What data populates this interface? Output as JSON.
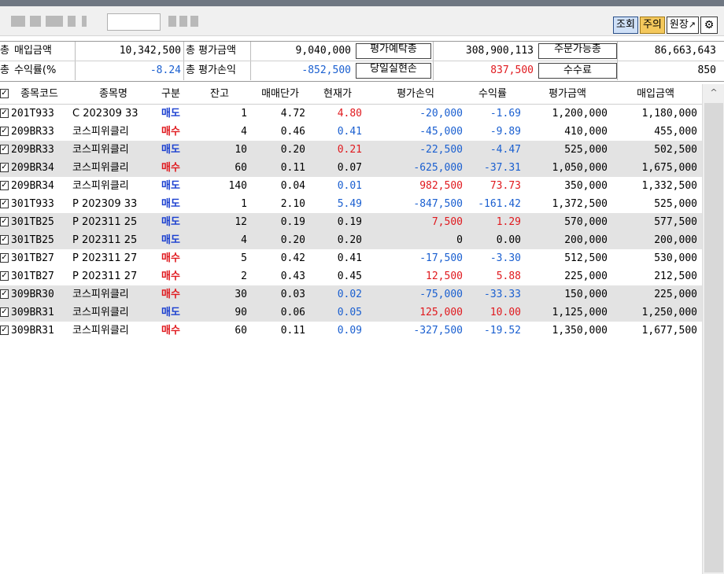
{
  "toolbar": {
    "query_label": "조회",
    "caution_label": "주의",
    "ledger_label": "원장",
    "ledger_icon": "external-link-icon",
    "settings_icon": "gear-icon"
  },
  "summary": {
    "row1": {
      "purchase_amount_label": "매입금액",
      "purchase_amount_value": "10,342,500",
      "total_eval_label": "총 평가금액",
      "total_eval_value": "9,040,000",
      "eval_deposit_button": "평가예탁총",
      "eval_deposit_value": "308,900,113",
      "orderable_button": "주문가능총",
      "orderable_value": "86,663,643"
    },
    "row2": {
      "return_rate_label": "수익률(%",
      "return_rate_value": "-8.24",
      "total_pl_label": "총 평가손익",
      "total_pl_value": "-852,500",
      "realized_button": "당일실현손",
      "realized_value": "837,500",
      "fee_button": "수수료",
      "fee_value": "850"
    },
    "prefix_total": "총",
    "prefix_total2": "총"
  },
  "table": {
    "headers": [
      "종목코드",
      "종목명",
      "구분",
      "잔고",
      "매매단가",
      "현재가",
      "평가손익",
      "수익률",
      "평가금액",
      "매입금액"
    ],
    "rows": [
      {
        "code": "201T933",
        "name": "C 202309 33",
        "side": "매도",
        "qty": "1",
        "avg": "4.72",
        "cur": "4.80",
        "pl": "-20,000",
        "rate": "-1.69",
        "eval": "1,200,000",
        "buy": "1,180,000",
        "cur_c": "pos",
        "pl_c": "neg",
        "rate_c": "neg"
      },
      {
        "code": "209BR33",
        "name": "코스피위클리",
        "side": "매수",
        "qty": "4",
        "avg": "0.46",
        "cur": "0.41",
        "pl": "-45,000",
        "rate": "-9.89",
        "eval": "410,000",
        "buy": "455,000",
        "cur_c": "neg",
        "pl_c": "neg",
        "rate_c": "neg"
      },
      {
        "code": "209BR33",
        "name": "코스피위클리",
        "side": "매도",
        "qty": "10",
        "avg": "0.20",
        "cur": "0.21",
        "pl": "-22,500",
        "rate": "-4.47",
        "eval": "525,000",
        "buy": "502,500",
        "cur_c": "pos",
        "pl_c": "neg",
        "rate_c": "neg"
      },
      {
        "code": "209BR34",
        "name": "코스피위클리",
        "side": "매수",
        "qty": "60",
        "avg": "0.11",
        "cur": "0.07",
        "pl": "-625,000",
        "rate": "-37.31",
        "eval": "1,050,000",
        "buy": "1,675,000",
        "cur_c": "",
        "pl_c": "neg",
        "rate_c": "neg"
      },
      {
        "code": "209BR34",
        "name": "코스피위클리",
        "side": "매도",
        "qty": "140",
        "avg": "0.04",
        "cur": "0.01",
        "pl": "982,500",
        "rate": "73.73",
        "eval": "350,000",
        "buy": "1,332,500",
        "cur_c": "neg",
        "pl_c": "pos",
        "rate_c": "pos"
      },
      {
        "code": "301T933",
        "name": "P 202309 33",
        "side": "매도",
        "qty": "1",
        "avg": "2.10",
        "cur": "5.49",
        "pl": "-847,500",
        "rate": "-161.42",
        "eval": "1,372,500",
        "buy": "525,000",
        "cur_c": "neg",
        "pl_c": "neg",
        "rate_c": "neg"
      },
      {
        "code": "301TB25",
        "name": "P 202311 25",
        "side": "매도",
        "qty": "12",
        "avg": "0.19",
        "cur": "0.19",
        "pl": "7,500",
        "rate": "1.29",
        "eval": "570,000",
        "buy": "577,500",
        "cur_c": "",
        "pl_c": "pos",
        "rate_c": "pos"
      },
      {
        "code": "301TB25",
        "name": "P 202311 25",
        "side": "매도",
        "qty": "4",
        "avg": "0.20",
        "cur": "0.20",
        "pl": "0",
        "rate": "0.00",
        "eval": "200,000",
        "buy": "200,000",
        "cur_c": "",
        "pl_c": "",
        "rate_c": ""
      },
      {
        "code": "301TB27",
        "name": "P 202311 27",
        "side": "매수",
        "qty": "5",
        "avg": "0.42",
        "cur": "0.41",
        "pl": "-17,500",
        "rate": "-3.30",
        "eval": "512,500",
        "buy": "530,000",
        "cur_c": "",
        "pl_c": "neg",
        "rate_c": "neg"
      },
      {
        "code": "301TB27",
        "name": "P 202311 27",
        "side": "매수",
        "qty": "2",
        "avg": "0.43",
        "cur": "0.45",
        "pl": "12,500",
        "rate": "5.88",
        "eval": "225,000",
        "buy": "212,500",
        "cur_c": "",
        "pl_c": "pos",
        "rate_c": "pos"
      },
      {
        "code": "309BR30",
        "name": "코스피위클리",
        "side": "매수",
        "qty": "30",
        "avg": "0.03",
        "cur": "0.02",
        "pl": "-75,000",
        "rate": "-33.33",
        "eval": "150,000",
        "buy": "225,000",
        "cur_c": "neg",
        "pl_c": "neg",
        "rate_c": "neg"
      },
      {
        "code": "309BR31",
        "name": "코스피위클리",
        "side": "매도",
        "qty": "90",
        "avg": "0.06",
        "cur": "0.05",
        "pl": "125,000",
        "rate": "10.00",
        "eval": "1,125,000",
        "buy": "1,250,000",
        "cur_c": "neg",
        "pl_c": "pos",
        "rate_c": "pos"
      },
      {
        "code": "309BR31",
        "name": "코스피위클리",
        "side": "매수",
        "qty": "60",
        "avg": "0.11",
        "cur": "0.09",
        "pl": "-327,500",
        "rate": "-19.52",
        "eval": "1,350,000",
        "buy": "1,677,500",
        "cur_c": "neg",
        "pl_c": "neg",
        "rate_c": "neg"
      }
    ],
    "check_mark": "✓",
    "scroll_up_glyph": "^"
  },
  "colors": {
    "positive": "#e0191e",
    "negative": "#1a5fd0",
    "buy": "#e0191e",
    "sell": "#1a3fd0",
    "row_shade": "#e3e3e3"
  }
}
